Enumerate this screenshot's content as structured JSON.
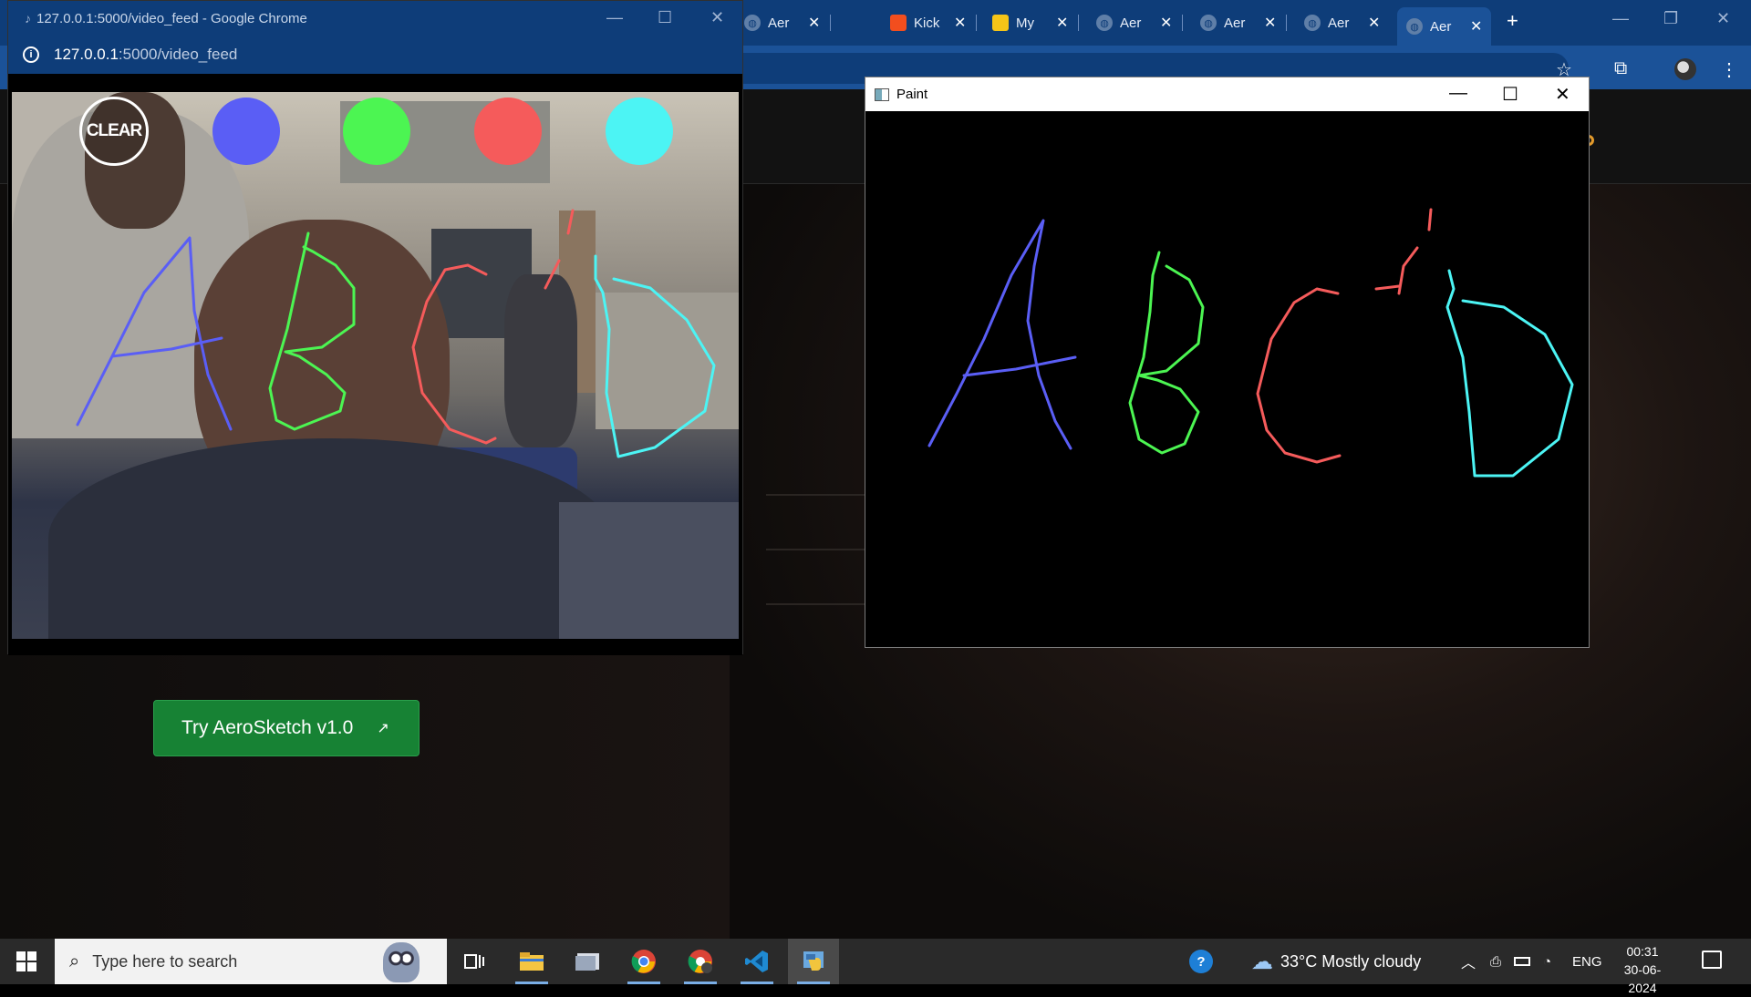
{
  "background_browser": {
    "tabs": [
      {
        "label": "Aer",
        "icon": "globe-icon"
      },
      {
        "label": "Kick",
        "icon": "figma-icon"
      },
      {
        "label": "My",
        "icon": "mortarboard-icon"
      },
      {
        "label": "Aer",
        "icon": "globe-icon"
      },
      {
        "label": "Aer",
        "icon": "globe-icon"
      },
      {
        "label": "Aer",
        "icon": "globe-icon"
      }
    ],
    "active_tab": {
      "label": "Aer",
      "icon": "globe-icon"
    },
    "close_glyph": "✕",
    "newtab_glyph": "+",
    "page": {
      "try_button_label": "Try AeroSketch v1.0",
      "try_button_arrow": "↗"
    },
    "colors": {
      "tabstrip": "#0e3d79",
      "toolbar": "#1b5298",
      "button": "#178234"
    }
  },
  "video_window": {
    "title": "127.0.0.1:5000/video_feed - Google Chrome",
    "url_host": "127.0.0.1",
    "url_path": ":5000/video_feed",
    "clear_label": "CLEAR",
    "palette": [
      "#5a5ef5",
      "#4cf552",
      "#f55b5b",
      "#4cf4f4"
    ]
  },
  "paint_window": {
    "title": "Paint",
    "strokes_colors": {
      "A": "#5a5ef5",
      "B": "#4cf552",
      "C": "#f55b5b",
      "D": "#4cf4f4"
    }
  },
  "taskbar": {
    "search_placeholder": "Type here to search",
    "weather_temp": "33°C",
    "weather_text": "Mostly cloudy",
    "language": "ENG",
    "time": "00:31",
    "date": "30-06-2024"
  }
}
